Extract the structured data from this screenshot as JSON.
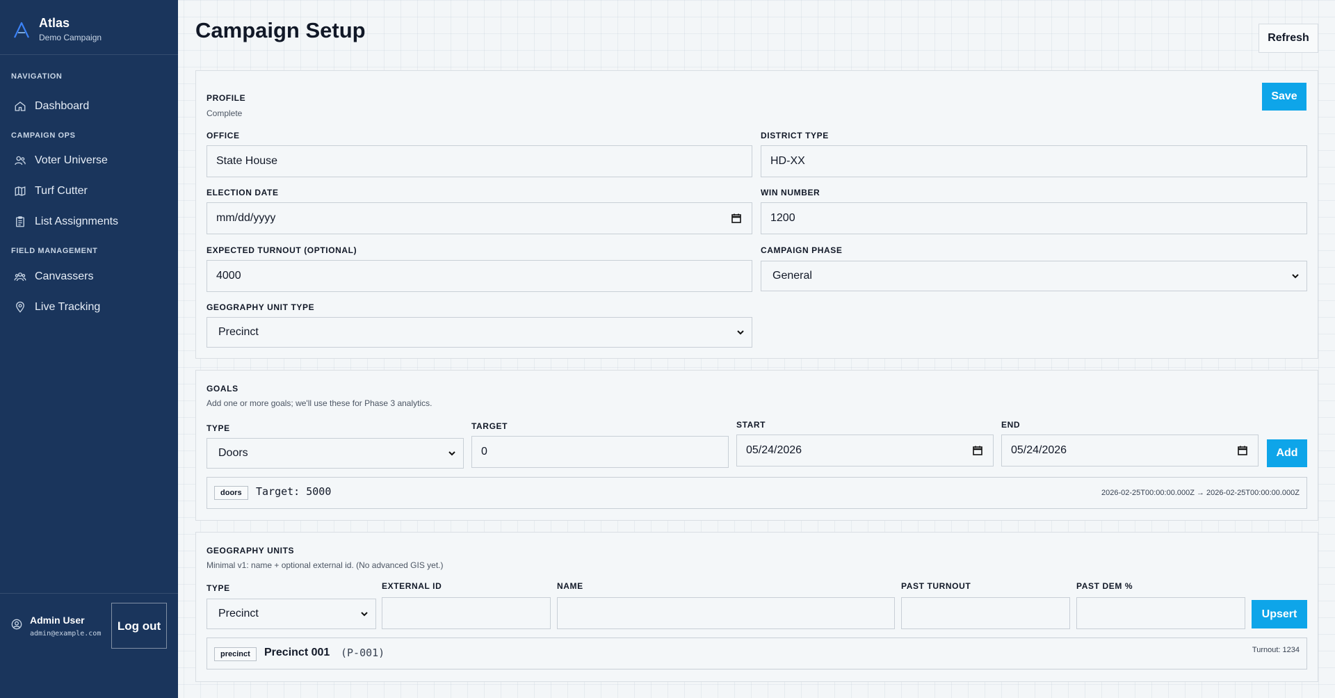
{
  "brand": {
    "name": "Atlas",
    "subtitle": "Demo Campaign"
  },
  "nav": {
    "section_navigation": "NAVIGATION",
    "dashboard": "Dashboard",
    "section_campaign_ops": "CAMPAIGN OPS",
    "voter_universe": "Voter Universe",
    "turf_cutter": "Turf Cutter",
    "list_assignments": "List Assignments",
    "section_field_management": "FIELD MANAGEMENT",
    "canvassers": "Canvassers",
    "live_tracking": "Live Tracking"
  },
  "user": {
    "name": "Admin User",
    "email": "admin@example.com",
    "logout": "Log out"
  },
  "header": {
    "title": "Campaign Setup",
    "refresh": "Refresh"
  },
  "profile": {
    "title": "PROFILE",
    "status": "Complete",
    "save": "Save",
    "office_label": "OFFICE",
    "office_value": "State House",
    "district_label": "DISTRICT TYPE",
    "district_value": "HD-XX",
    "election_label": "ELECTION DATE",
    "election_placeholder": "mm/dd/yyyy",
    "win_label": "WIN NUMBER",
    "win_value": "1200",
    "turnout_label": "EXPECTED TURNOUT (OPTIONAL)",
    "turnout_value": "4000",
    "phase_label": "CAMPAIGN PHASE",
    "phase_value": "General",
    "geo_type_label": "GEOGRAPHY UNIT TYPE",
    "geo_type_value": "Precinct"
  },
  "goals": {
    "title": "GOALS",
    "subtitle": "Add one or more goals; we'll use these for Phase 3 analytics.",
    "type_label": "TYPE",
    "type_value": "Doors",
    "target_label": "TARGET",
    "target_value": "0",
    "start_label": "START",
    "start_value": "05/24/2026",
    "end_label": "END",
    "end_value": "05/24/2026",
    "add": "Add",
    "items": [
      {
        "tag": "doors",
        "target": "Target: 5000",
        "range": "2026-02-25T00:00:00.000Z → 2026-02-25T00:00:00.000Z"
      }
    ]
  },
  "geography": {
    "title": "GEOGRAPHY UNITS",
    "subtitle": "Minimal v1: name + optional external id. (No advanced GIS yet.)",
    "type_label": "TYPE",
    "type_value": "Precinct",
    "external_id_label": "EXTERNAL ID",
    "name_label": "NAME",
    "past_turnout_label": "PAST TURNOUT",
    "past_dem_label": "PAST DEM %",
    "upsert": "Upsert",
    "items": [
      {
        "tag": "precinct",
        "name": "Precinct 001",
        "external_id": "(P-001)",
        "turnout": "Turnout: 1234"
      }
    ]
  },
  "colors": {
    "sidebar": "#1a355c",
    "accent": "#0ea5e9"
  }
}
